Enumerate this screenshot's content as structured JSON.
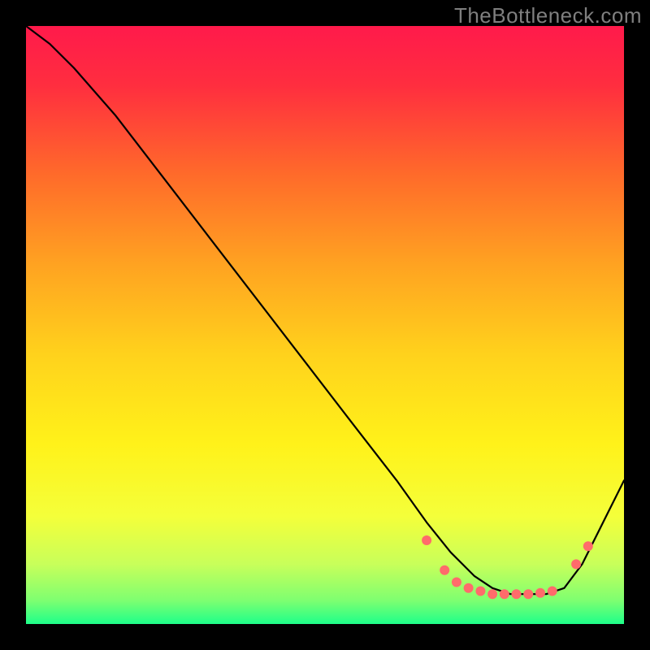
{
  "watermark": "TheBottleneck.com",
  "chart_data": {
    "type": "line",
    "title": "",
    "xlabel": "",
    "ylabel": "",
    "xlim": [
      0,
      100
    ],
    "ylim": [
      0,
      100
    ],
    "background_gradient": {
      "stops": [
        {
          "offset": 0.0,
          "color": "#ff1a4b"
        },
        {
          "offset": 0.1,
          "color": "#ff2e3f"
        },
        {
          "offset": 0.25,
          "color": "#ff6b2a"
        },
        {
          "offset": 0.4,
          "color": "#ffa321"
        },
        {
          "offset": 0.55,
          "color": "#ffd21c"
        },
        {
          "offset": 0.7,
          "color": "#fff21a"
        },
        {
          "offset": 0.82,
          "color": "#f4ff3a"
        },
        {
          "offset": 0.9,
          "color": "#c8ff5a"
        },
        {
          "offset": 0.96,
          "color": "#7fff70"
        },
        {
          "offset": 1.0,
          "color": "#1eff8a"
        }
      ]
    },
    "series": [
      {
        "name": "curve",
        "color": "#000000",
        "x": [
          0,
          4,
          8,
          15,
          25,
          35,
          45,
          55,
          62,
          67,
          71,
          75,
          78,
          81,
          84,
          87,
          90,
          93,
          96,
          100
        ],
        "y": [
          100,
          97,
          93,
          85,
          72,
          59,
          46,
          33,
          24,
          17,
          12,
          8,
          6,
          5,
          5,
          5,
          6,
          10,
          16,
          24
        ]
      }
    ],
    "markers": {
      "name": "bottom-dots",
      "color": "#ff6b6b",
      "radius": 6,
      "x": [
        67,
        70,
        72,
        74,
        76,
        78,
        80,
        82,
        84,
        86,
        88,
        92,
        94
      ],
      "y": [
        14,
        9,
        7,
        6,
        5.5,
        5,
        5,
        5,
        5,
        5.2,
        5.5,
        10,
        13
      ]
    }
  }
}
